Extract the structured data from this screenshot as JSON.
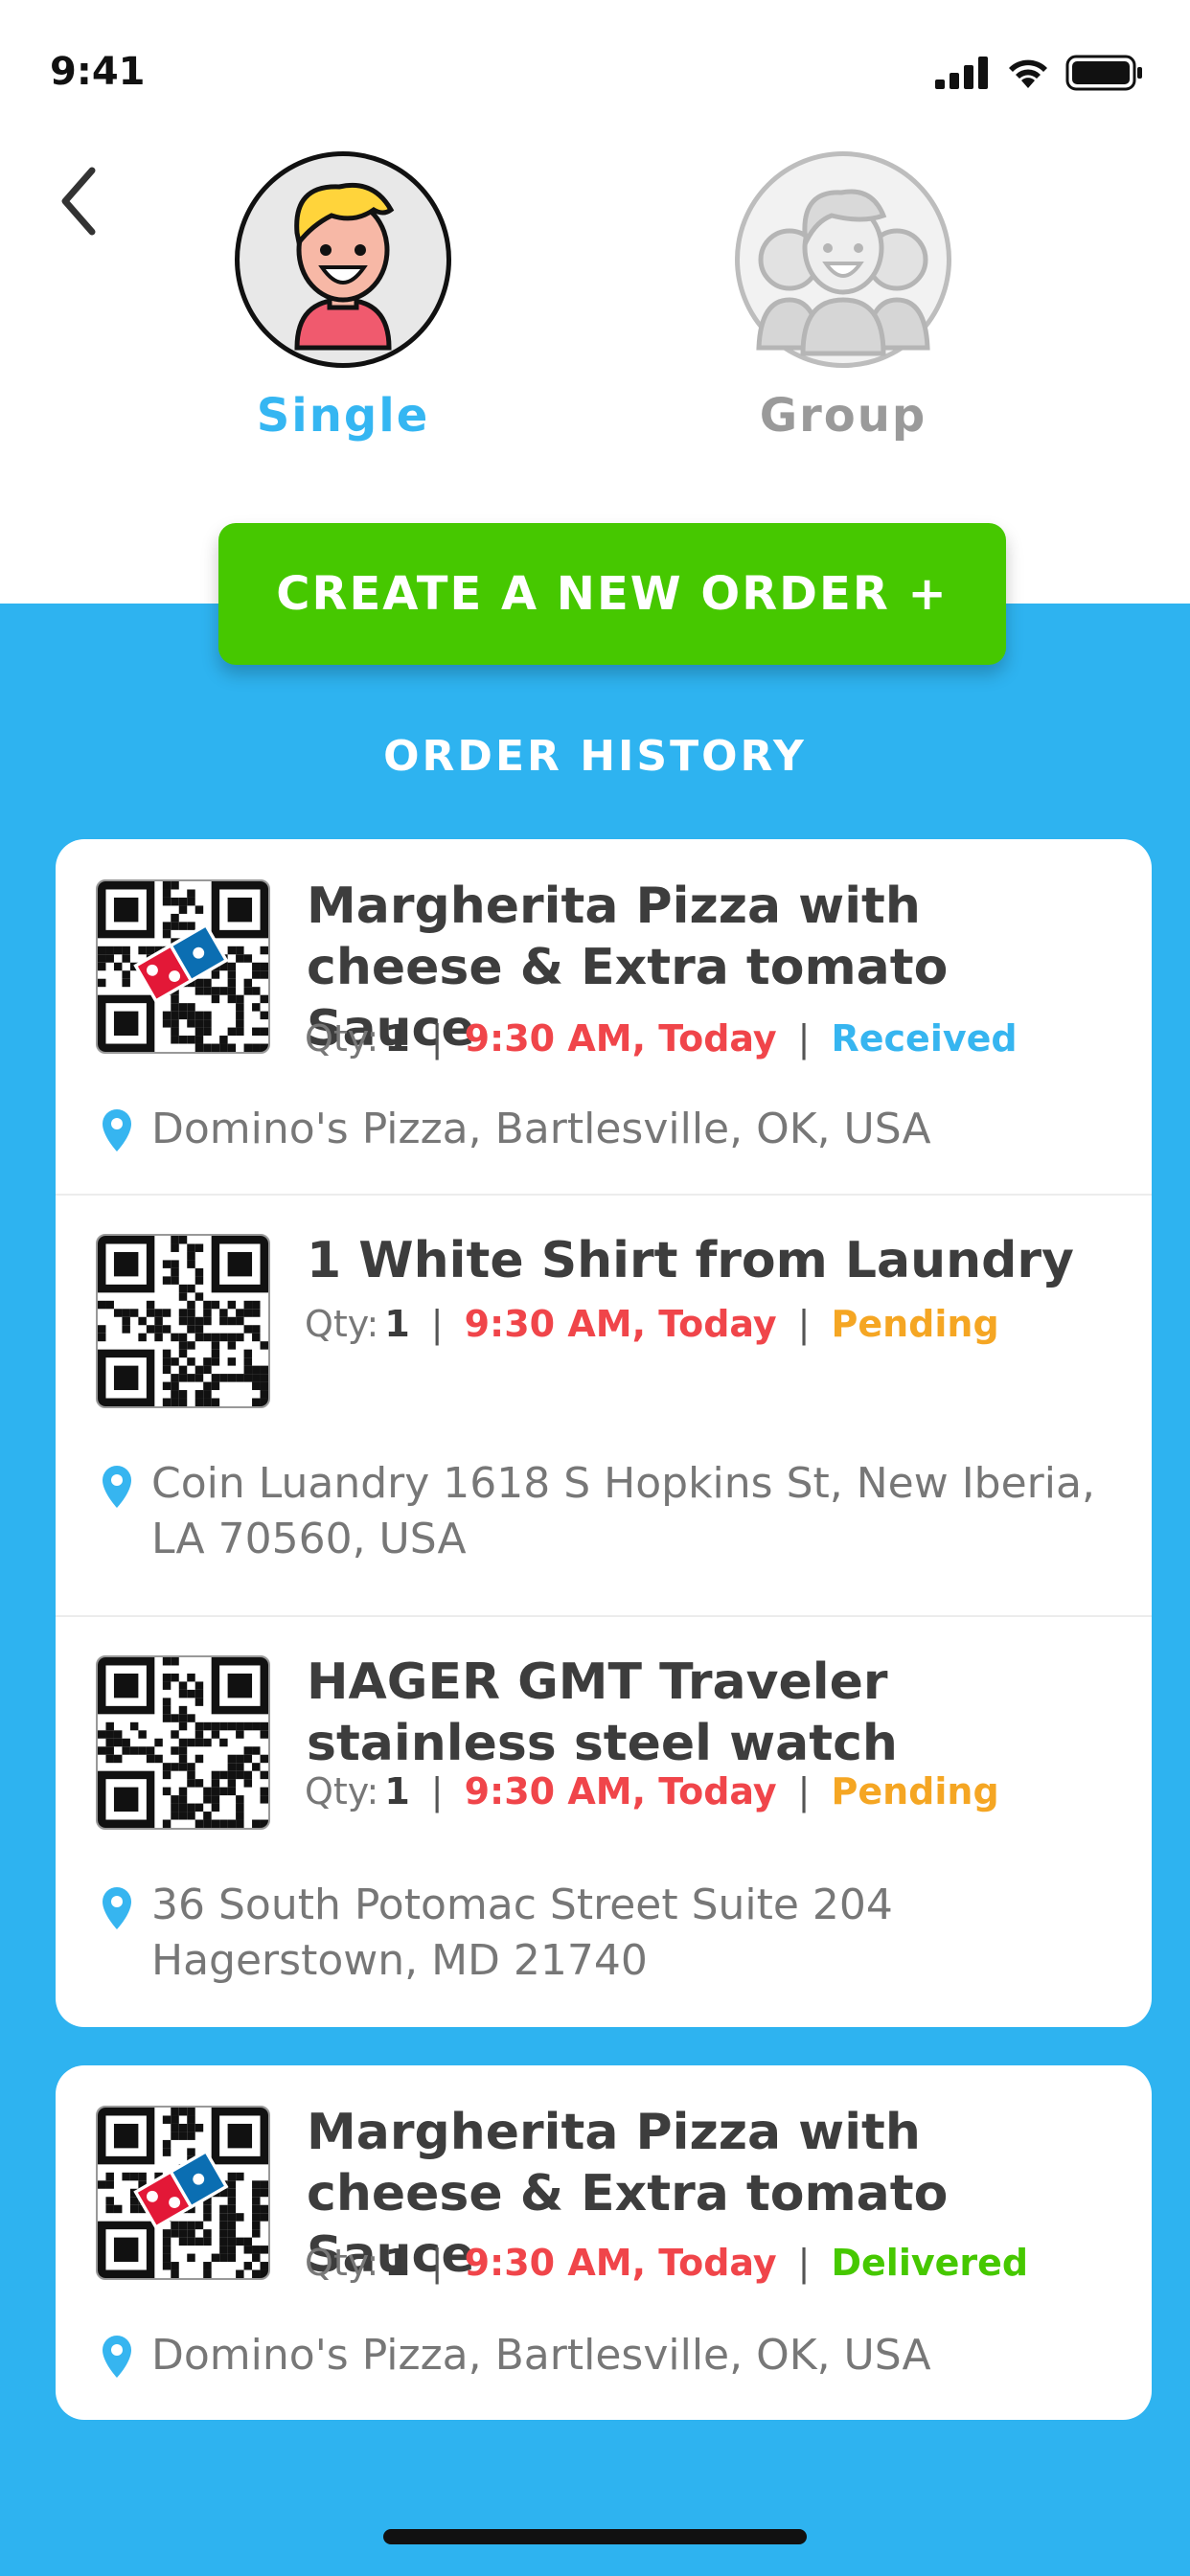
{
  "status_bar": {
    "time": "9:41"
  },
  "tabs": {
    "single_label": "Single",
    "group_label": "Group"
  },
  "create_button_label": "CREATE A NEW ORDER +",
  "history_title": "ORDER HISTORY",
  "qty_label": "Qty:",
  "orders": [
    {
      "title": "Margherita Pizza with cheese & Extra tomato Sauce",
      "qty": "1",
      "time": "9:30 AM, Today",
      "status": "Received",
      "status_color": "#36b5f0",
      "address": "Domino's Pizza, Bartlesville, OK, USA",
      "qr_brand": "Domino's Pizza"
    },
    {
      "title": "1 White Shirt from Laundry",
      "qty": "1",
      "time": "9:30 AM, Today",
      "status": "Pending",
      "status_color": "#f5a623",
      "address": "Coin Luandry 1618 S Hopkins St, New Iberia, LA 70560, USA"
    },
    {
      "title": "HAGER GMT Traveler stainless steel watch",
      "qty": "1",
      "time": "9:30 AM, Today",
      "status": "Pending",
      "status_color": "#f5a623",
      "address": "36 South Potomac Street Suite 204 Hagerstown, MD 21740"
    },
    {
      "title": "Margherita Pizza with cheese & Extra tomato Sauce",
      "qty": "1",
      "time": "9:30 AM, Today",
      "status": "Delivered",
      "status_color": "#46c800",
      "address": "Domino's Pizza, Bartlesville, OK, USA",
      "qr_brand": "Domino's Pizza"
    }
  ],
  "colors": {
    "primary_blue": "#2eb3f0",
    "create_green": "#46c800",
    "time_red": "#f0454a"
  }
}
